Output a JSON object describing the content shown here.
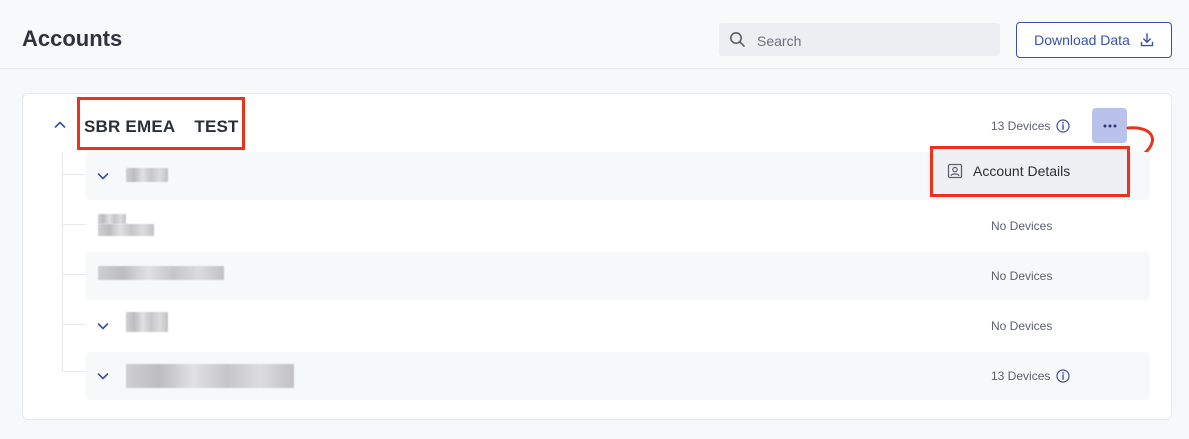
{
  "header": {
    "title": "Accounts",
    "search_placeholder": "Search",
    "download_label": "Download Data"
  },
  "account": {
    "name": "SBR EMEA    TEST",
    "devices": "13 Devices",
    "menu": {
      "items": [
        {
          "label": "Account Details",
          "icon": "account-card-icon"
        }
      ]
    }
  },
  "rows": [
    {
      "name": "",
      "devices": "",
      "expandable": true
    },
    {
      "name": "",
      "devices": "No Devices",
      "expandable": false
    },
    {
      "name": "",
      "devices": "No Devices",
      "expandable": false
    },
    {
      "name": "",
      "devices": "No Devices",
      "expandable": true
    },
    {
      "name": "",
      "devices": "13 Devices",
      "expandable": true
    }
  ],
  "colors": {
    "accent": "#3a4fa6",
    "highlight": "#e8341c",
    "more_button_bg": "#b9c2ea"
  }
}
